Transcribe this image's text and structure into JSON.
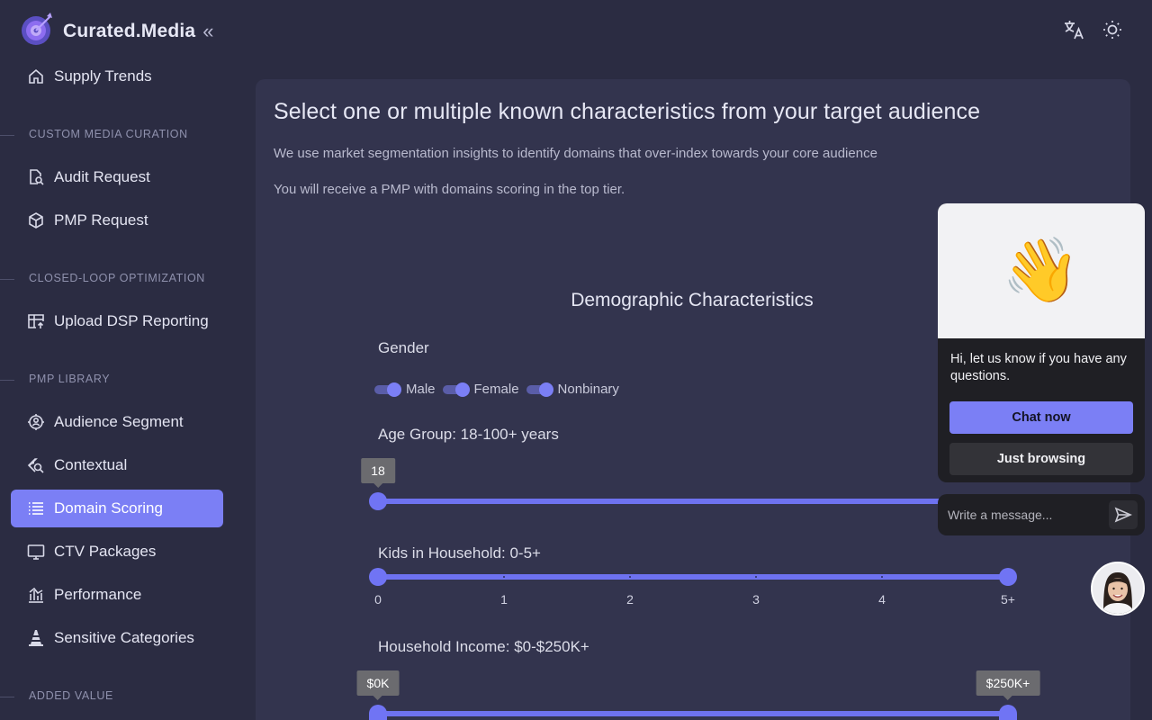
{
  "brand": {
    "title": "Curated.Media",
    "collapse_icon": "«"
  },
  "sidebar": {
    "items": [
      {
        "label": "Supply Trends",
        "icon": "home-icon"
      },
      {
        "label": "Audit Request",
        "icon": "document-search-icon"
      },
      {
        "label": "PMP Request",
        "icon": "cube-icon"
      },
      {
        "label": "Upload DSP Reporting",
        "icon": "table-upload-icon"
      },
      {
        "label": "Audience Segment",
        "icon": "target-user-icon"
      },
      {
        "label": "Contextual",
        "icon": "tag-search-icon"
      },
      {
        "label": "Domain Scoring",
        "icon": "list-icon",
        "active": true
      },
      {
        "label": "CTV Packages",
        "icon": "tv-icon"
      },
      {
        "label": "Performance",
        "icon": "chart-icon"
      },
      {
        "label": "Sensitive Categories",
        "icon": "cone-icon"
      }
    ],
    "sections": [
      "CUSTOM MEDIA CURATION",
      "CLOSED-LOOP OPTIMIZATION",
      "PMP LIBRARY",
      "ADDED VALUE"
    ]
  },
  "main": {
    "title": "Select one or multiple known characteristics from your target audience",
    "desc1": "We use market segmentation insights to identify domains that over-index towards your core audience",
    "desc2": "You will receive a PMP with domains scoring in the top tier.",
    "demographics_title": "Demographic Characteristics",
    "gender": {
      "label": "Gender",
      "options": [
        {
          "label": "Male",
          "on": true
        },
        {
          "label": "Female",
          "on": true
        },
        {
          "label": "Nonbinary",
          "on": true
        }
      ]
    },
    "age": {
      "label": "Age Group: 18-100+ years",
      "min_value": "18",
      "min": 18,
      "max": 100
    },
    "kids": {
      "label": "Kids in Household: 0-5+",
      "ticks": [
        "0",
        "1",
        "2",
        "3",
        "4",
        "5+"
      ]
    },
    "income": {
      "label": "Household Income: $0-$250K+",
      "min_value": "$0K",
      "max_value": "$250K+"
    }
  },
  "chat": {
    "hero_emoji": "👋",
    "message": "Hi, let us know if you have any questions.",
    "primary_label": "Chat now",
    "secondary_label": "Just browsing",
    "input_placeholder": "Write a message..."
  },
  "colors": {
    "accent": "#7b7ff5",
    "background": "#2b2c42",
    "card": "#33344e"
  }
}
